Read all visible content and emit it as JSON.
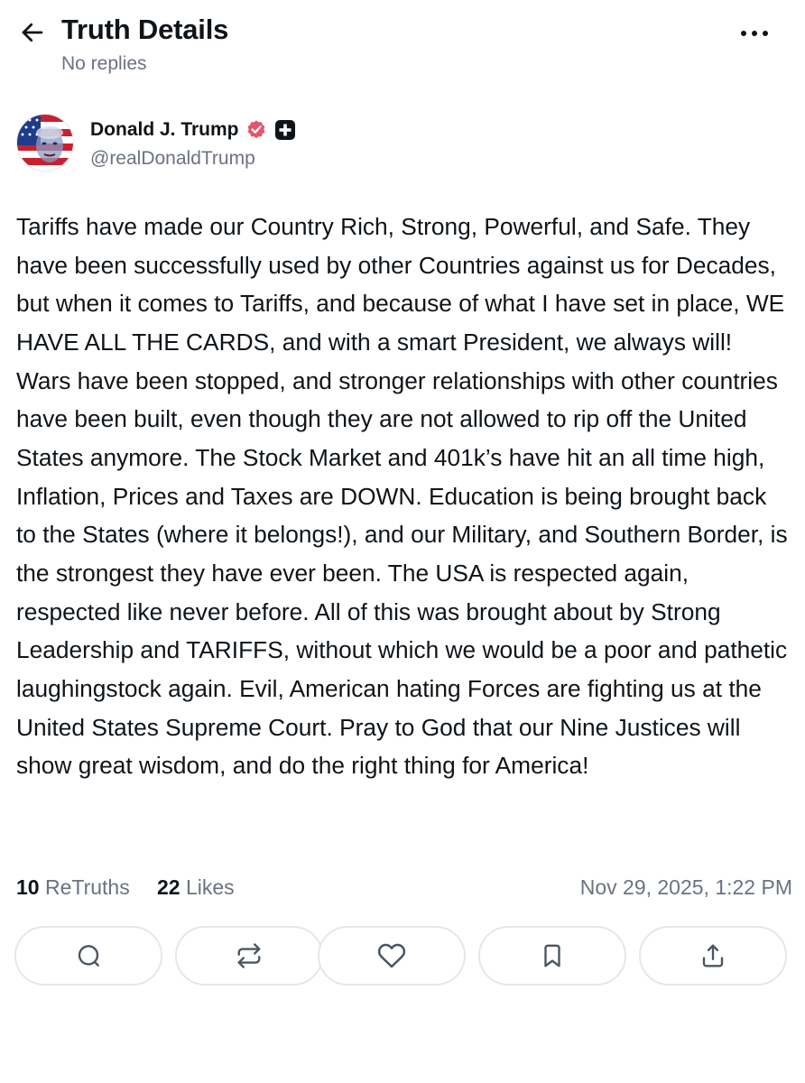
{
  "header": {
    "title": "Truth Details",
    "subtitle": "No replies"
  },
  "author": {
    "name": "Donald J. Trump",
    "handle": "@realDonaldTrump",
    "verified_color": "#e5556a"
  },
  "post": {
    "text": "Tariffs have made our Country Rich, Strong, Powerful, and Safe. They have been successfully used by other Countries against us for Decades, but when it comes to Tariffs, and because of what I have set in place, WE HAVE ALL THE CARDS, and with a smart President, we always will! Wars have been stopped, and stronger relationships with other countries have been built, even though they are not allowed to rip off the United States anymore. The Stock Market and 401k’s have hit an all time high, Inflation, Prices and Taxes are DOWN. Education is being brought back to the States (where it belongs!), and our Military, and Southern Border, is the strongest they have ever been. The USA is respected again, respected like never before. All of this was brought about by Strong Leadership and TARIFFS, without which we would be a poor and pathetic laughingstock again. Evil, American hating Forces are fighting us at the United States Supreme Court. Pray to God that our Nine Justices will show great wisdom, and do the right thing for America!"
  },
  "stats": {
    "retruths_count": "10",
    "retruths_label": "ReTruths",
    "likes_count": "22",
    "likes_label": "Likes",
    "timestamp": "Nov 29, 2025, 1:22 PM"
  },
  "actions": {
    "icons": [
      "reply-icon",
      "retruth-icon",
      "like-icon",
      "bookmark-icon",
      "share-icon"
    ]
  }
}
